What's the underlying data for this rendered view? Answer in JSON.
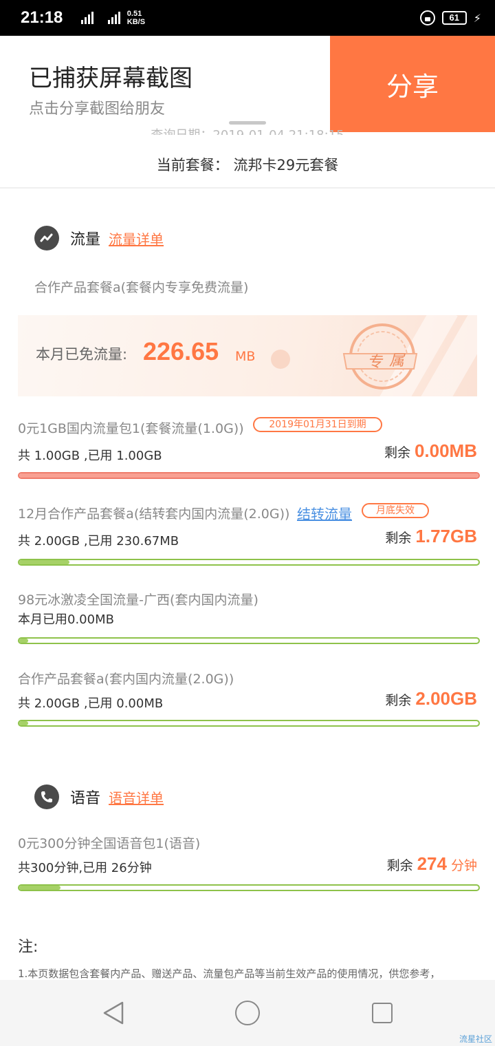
{
  "status_bar": {
    "time": "21:18",
    "net1": "4G",
    "net2": "2G",
    "speed_value": "0.51",
    "speed_unit": "KB/S",
    "battery": "61"
  },
  "toast": {
    "title": "已捕获屏幕截图",
    "subtitle": "点击分享截图给朋友",
    "share_label": "分享"
  },
  "header": {
    "query_date": "查询日期：2019-01-04 21:18:15",
    "plan_line": "当前套餐：   流邦卡29元套餐"
  },
  "data_section": {
    "title": "流量",
    "link": "流量详单",
    "package_desc": "合作产品套餐a(套餐内专享免费流量)",
    "banner": {
      "label": "本月已免流量:",
      "value": "226.65",
      "unit": "MB",
      "seal_char1": "专",
      "seal_char2": "属"
    },
    "items": [
      {
        "name": "0元1GB国内流量包1(套餐流量(1.0G))",
        "badge": "2019年01月31日到期",
        "usage": "共 1.00GB ,已用 1.00GB",
        "remain_label": "剩余",
        "remain_value": "0.00MB",
        "used_fraction": 1.0
      },
      {
        "name": "12月合作产品套餐a(结转套内国内流量(2.0G))",
        "link": "结转流量",
        "badge": "月底失效",
        "usage": "共 2.00GB ,已用 230.67MB",
        "remain_label": "剩余",
        "remain_value": "1.77GB",
        "used_fraction": 0.11
      },
      {
        "name": "98元冰激凌全国流量-广西(套内国内流量)",
        "usage": "本月已用0.00MB",
        "used_fraction": 0.02
      },
      {
        "name": "合作产品套餐a(套内国内流量(2.0G))",
        "usage": "共 2.00GB ,已用 0.00MB",
        "remain_label": "剩余",
        "remain_value": "2.00GB",
        "used_fraction": 0.02
      }
    ]
  },
  "voice_section": {
    "title": "语音",
    "link": "语音详单",
    "items": [
      {
        "name": "0元300分钟全国语音包1(语音)",
        "usage": "共300分钟,已用 26分钟",
        "remain_label": "剩余",
        "remain_value": "274",
        "remain_unit": "分钟",
        "used_fraction": 0.09
      }
    ]
  },
  "notes": {
    "title": "注:",
    "line1": "1.本页数据包含套餐内产品、赠送产品、流量包产品等当前生效产品的使用情况，供您参考，"
  },
  "watermark": "流星社区",
  "colors": {
    "accent": "#ff7743",
    "progress_green": "#a6d167",
    "progress_red": "#f8a092",
    "link_blue": "#4a90e2"
  }
}
